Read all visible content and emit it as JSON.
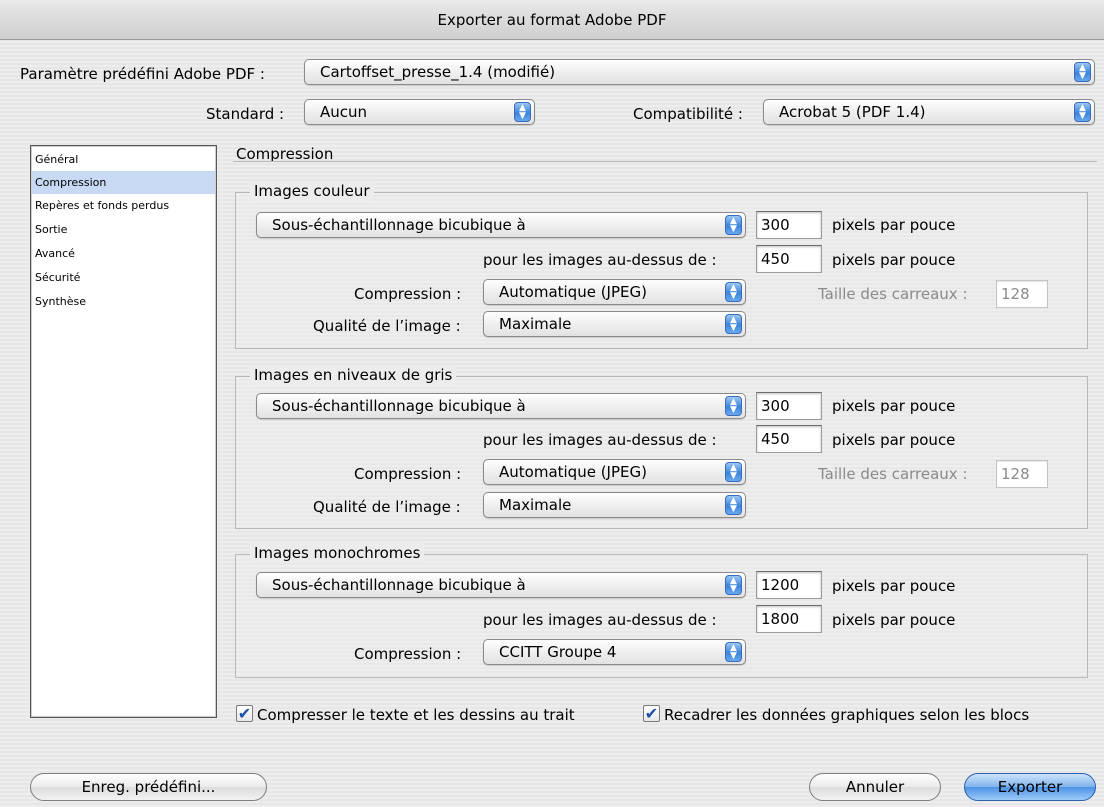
{
  "window": {
    "title": "Exporter au format Adobe PDF"
  },
  "preset": {
    "label": "Paramètre prédéfini Adobe PDF :",
    "value": "Cartoffset_presse_1.4 (modifié)"
  },
  "standard": {
    "label": "Standard :",
    "value": "Aucun"
  },
  "compat": {
    "label": "Compatibilité :",
    "value": "Acrobat 5 (PDF 1.4)"
  },
  "sidebar": {
    "items": [
      {
        "label": "Général"
      },
      {
        "label": "Compression"
      },
      {
        "label": "Repères et fonds perdus"
      },
      {
        "label": "Sortie"
      },
      {
        "label": "Avancé"
      },
      {
        "label": "Sécurité"
      },
      {
        "label": "Synthèse"
      }
    ],
    "selected_index": 1
  },
  "section": {
    "title": "Compression"
  },
  "units": "pixels par pouce",
  "labels": {
    "above": "pour les images au-dessus de :",
    "compression": "Compression :",
    "quality": "Qualité de l’image :",
    "tile": "Taille des carreaux :"
  },
  "color": {
    "title": "Images couleur",
    "sampling": "Sous-échantillonnage bicubique à",
    "ppi": "300",
    "above_ppi": "450",
    "compression": "Automatique (JPEG)",
    "tile": "128",
    "quality": "Maximale"
  },
  "gray": {
    "title": "Images en niveaux de gris",
    "sampling": "Sous-échantillonnage bicubique à",
    "ppi": "300",
    "above_ppi": "450",
    "compression": "Automatique (JPEG)",
    "tile": "128",
    "quality": "Maximale"
  },
  "mono": {
    "title": "Images monochromes",
    "sampling": "Sous-échantillonnage bicubique à",
    "ppi": "1200",
    "above_ppi": "1800",
    "compression": "CCITT Groupe 4"
  },
  "options": {
    "compress_text": {
      "label": "Compresser le texte et les dessins au trait",
      "checked": true
    },
    "crop_image": {
      "label": "Recadrer les données graphiques selon les blocs",
      "checked": true
    }
  },
  "buttons": {
    "save_preset": "Enreg. prédéfini...",
    "cancel": "Annuler",
    "export": "Exporter"
  },
  "glyphs": {
    "check": "✔",
    "updown": "▲▼"
  }
}
